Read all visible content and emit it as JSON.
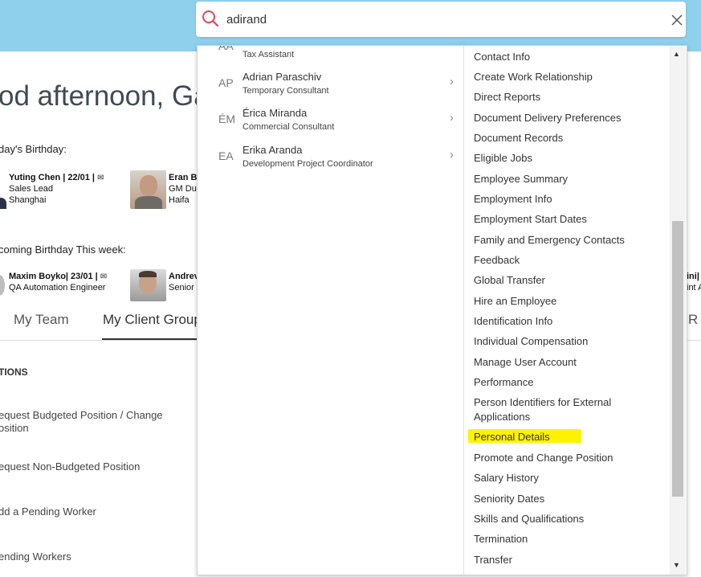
{
  "greeting": "od afternoon, Gali",
  "birthday": {
    "today_heading": "day's Birthday:",
    "upcoming_heading": "coming Birthday This week:",
    "today": [
      {
        "name": "Yuting Chen  | 22/01 |",
        "title": "Sales Lead",
        "location": "Shanghai"
      },
      {
        "name": "Eran Ba",
        "title": "GM Du",
        "location": "Haifa"
      }
    ],
    "upcoming": [
      {
        "name": "Maxim Boyko| 23/01 |",
        "title": "QA Automation Engineer"
      },
      {
        "name": "Andrev",
        "title": "Senior /"
      },
      {
        "name": "ini|",
        "title": "int As"
      }
    ]
  },
  "tabs": [
    "My Team",
    "My Client Group",
    "R"
  ],
  "actions": {
    "section_title": "TIONS",
    "items": [
      "equest Budgeted Position / Change\nosition",
      "equest Non-Budgeted Position",
      "dd a Pending Worker",
      "ending Workers"
    ]
  },
  "search": {
    "value": "adirand"
  },
  "people": [
    {
      "initials": "AA",
      "name": "",
      "title": "Tax Assistant"
    },
    {
      "initials": "AP",
      "name": "Adrian Paraschiv",
      "title": "Temporary Consultant"
    },
    {
      "initials": "ÉM",
      "name": "Érica Miranda",
      "title": "Commercial Consultant"
    },
    {
      "initials": "EA",
      "name": "Erika Aranda",
      "title": "Development Project Coordinator"
    }
  ],
  "tasks": [
    "Contact Info",
    "Create Work Relationship",
    "Direct Reports",
    "Document Delivery Preferences",
    "Document Records",
    "Eligible Jobs",
    "Employee Summary",
    "Employment Info",
    "Employment Start Dates",
    "Family and Emergency Contacts",
    "Feedback",
    "Global Transfer",
    "Hire an Employee",
    "Identification Info",
    "Individual Compensation",
    "Manage User Account",
    "Performance",
    "Person Identifiers for External\nApplications",
    "Personal Details",
    "Promote and Change Position",
    "Salary History",
    "Seniority Dates",
    "Skills and Qualifications",
    "Termination",
    "Transfer"
  ],
  "colors": {
    "header": "#8fd0ec",
    "search_icon": "#e0455a",
    "highlight": "#fff200"
  }
}
